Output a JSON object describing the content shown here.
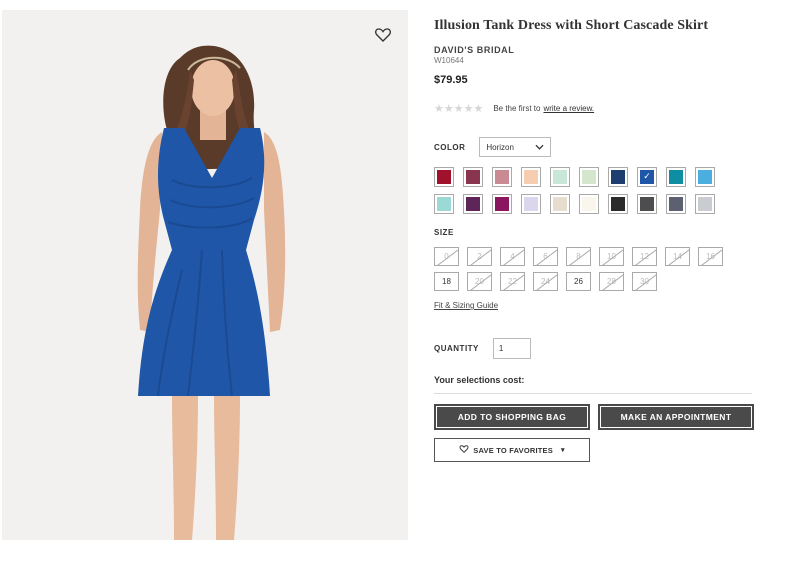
{
  "product": {
    "title": "Illusion Tank Dress with Short Cascade Skirt",
    "brand": "DAVID'S BRIDAL",
    "sku": "W10644",
    "price": "$79.95"
  },
  "rating": {
    "stars": "★★★★★",
    "prefix": "Be the first to",
    "link": "write a review."
  },
  "color": {
    "label": "COLOR",
    "selected": "Horizon",
    "swatches": [
      {
        "name": "red",
        "hex": "#a0122c",
        "selected": false
      },
      {
        "name": "wine",
        "hex": "#8a3550",
        "selected": false
      },
      {
        "name": "mauve",
        "hex": "#c98a93",
        "selected": false
      },
      {
        "name": "peach",
        "hex": "#f6cdb1",
        "selected": false
      },
      {
        "name": "mint",
        "hex": "#c9e7d8",
        "selected": false
      },
      {
        "name": "sage",
        "hex": "#d4e6cc",
        "selected": false
      },
      {
        "name": "navy",
        "hex": "#1d3e6e",
        "selected": false
      },
      {
        "name": "horizon",
        "hex": "#1f56a8",
        "selected": true
      },
      {
        "name": "teal",
        "hex": "#0f8ea3",
        "selected": false
      },
      {
        "name": "sky",
        "hex": "#4aaedf",
        "selected": false
      },
      {
        "name": "aqua",
        "hex": "#9ad9d6",
        "selected": false
      },
      {
        "name": "plum",
        "hex": "#5e2559",
        "selected": false
      },
      {
        "name": "magenta",
        "hex": "#8b1660",
        "selected": false
      },
      {
        "name": "lavender",
        "hex": "#dcd6ec",
        "selected": false
      },
      {
        "name": "champagne",
        "hex": "#e6ddcf",
        "selected": false
      },
      {
        "name": "ivory",
        "hex": "#faf6ee",
        "selected": false
      },
      {
        "name": "black",
        "hex": "#2b2b2b",
        "selected": false
      },
      {
        "name": "charcoal",
        "hex": "#4d4d4f",
        "selected": false
      },
      {
        "name": "slate",
        "hex": "#5c6170",
        "selected": false
      },
      {
        "name": "silver",
        "hex": "#c9cdd1",
        "selected": false
      }
    ]
  },
  "size": {
    "label": "SIZE",
    "options": [
      {
        "value": "0",
        "available": false
      },
      {
        "value": "2",
        "available": false
      },
      {
        "value": "4",
        "available": false
      },
      {
        "value": "6",
        "available": false
      },
      {
        "value": "8",
        "available": false
      },
      {
        "value": "10",
        "available": false
      },
      {
        "value": "12",
        "available": false
      },
      {
        "value": "14",
        "available": false
      },
      {
        "value": "16",
        "available": false
      },
      {
        "value": "18",
        "available": true
      },
      {
        "value": "20",
        "available": false
      },
      {
        "value": "22",
        "available": false
      },
      {
        "value": "24",
        "available": false
      },
      {
        "value": "26",
        "available": true
      },
      {
        "value": "28",
        "available": false
      },
      {
        "value": "30",
        "available": false
      }
    ],
    "guide_link": "Fit & Sizing Guide"
  },
  "quantity": {
    "label": "QUANTITY",
    "value": "1"
  },
  "cost_label": "Your selections cost:",
  "buttons": {
    "add_to_bag": "ADD TO SHOPPING BAG",
    "appointment": "MAKE AN APPOINTMENT",
    "save_favorites": "SAVE TO FAVORITES"
  },
  "image": {
    "dress_color": "#1f56a8",
    "background": "#f3f1ef"
  }
}
